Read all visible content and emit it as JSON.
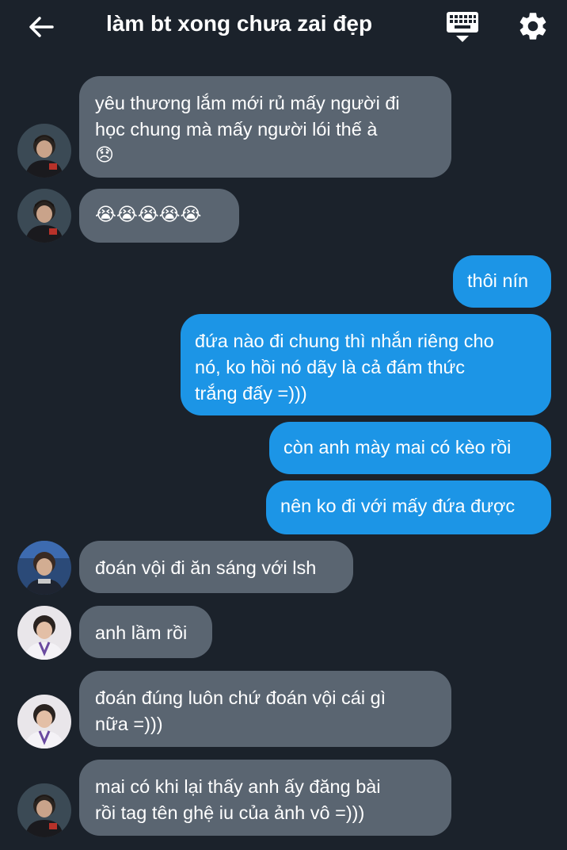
{
  "header": {
    "title": "làm bt xong chưa zai đẹp",
    "back_icon": "arrow-left-icon",
    "keyboard_icon": "keyboard-hide-icon",
    "settings_icon": "gear-icon"
  },
  "colors": {
    "background": "#1b222b",
    "incoming_bubble": "#5a6571",
    "outgoing_bubble": "#1c95e6",
    "text": "#ffffff"
  },
  "messages": [
    {
      "direction": "incoming",
      "text": "yêu thương lắm mới rủ mấy người đi học chung mà mấy người lói thế à 😞",
      "line1": "yêu thương lắm mới rủ mấy người đi",
      "line2": "học chung mà mấy người lói thế à",
      "emoji": "😞"
    },
    {
      "direction": "incoming",
      "text": "😭😭😭😭😭"
    },
    {
      "direction": "outgoing",
      "text": "thôi nín"
    },
    {
      "direction": "outgoing",
      "text": "đứa nào đi chung thì nhắn riêng cho nó, ko hồi nó dãy là cả đám thức trắng đấy =)))",
      "line1": "đứa nào đi chung thì nhắn riêng cho",
      "line2": "nó, ko hồi nó dãy là cả đám thức",
      "line3": "trắng đấy =)))"
    },
    {
      "direction": "outgoing",
      "text": "còn anh mày mai có kèo rồi"
    },
    {
      "direction": "outgoing",
      "text": "nên ko đi với mấy đứa được"
    },
    {
      "direction": "incoming",
      "text": "đoán vội đi ăn sáng với lsh"
    },
    {
      "direction": "incoming",
      "text": "anh lầm rồi"
    },
    {
      "direction": "incoming",
      "text": "đoán đúng luôn chứ đoán vội cái gì nữa =)))",
      "line1": "đoán đúng luôn chứ đoán vội cái gì",
      "line2": "nữa =)))"
    },
    {
      "direction": "incoming",
      "text": "mai có khi lại thấy anh ấy đăng bài rồi tag tên ghệ iu của ảnh vô =)))",
      "line1": "mai có khi lại thấy anh ấy đăng bài",
      "line2": "rồi tag tên ghệ iu của ảnh vô =)))"
    }
  ]
}
